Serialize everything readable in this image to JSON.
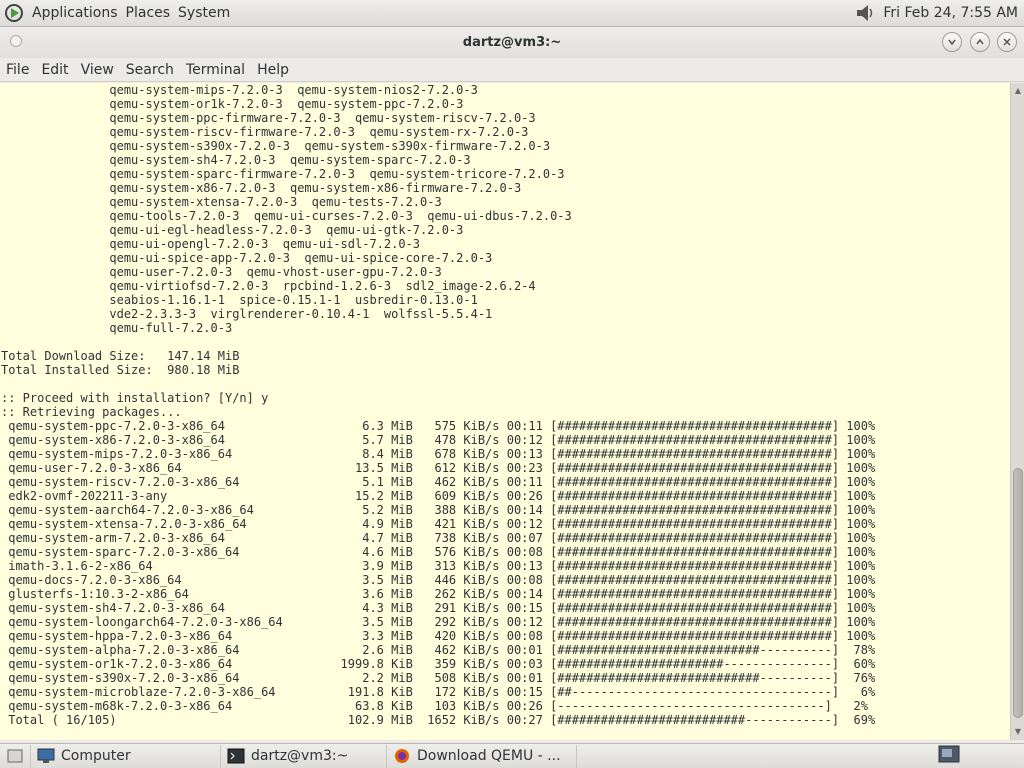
{
  "topbar": {
    "menus": [
      "Applications",
      "Places",
      "System"
    ],
    "clock": "Fri Feb 24,  7:55 AM"
  },
  "window": {
    "title": "dartz@vm3:~"
  },
  "menubar": [
    "File",
    "Edit",
    "View",
    "Search",
    "Terminal",
    "Help"
  ],
  "terminal": {
    "lines": [
      "               qemu-system-mips-7.2.0-3  qemu-system-nios2-7.2.0-3",
      "               qemu-system-or1k-7.2.0-3  qemu-system-ppc-7.2.0-3",
      "               qemu-system-ppc-firmware-7.2.0-3  qemu-system-riscv-7.2.0-3",
      "               qemu-system-riscv-firmware-7.2.0-3  qemu-system-rx-7.2.0-3",
      "               qemu-system-s390x-7.2.0-3  qemu-system-s390x-firmware-7.2.0-3",
      "               qemu-system-sh4-7.2.0-3  qemu-system-sparc-7.2.0-3",
      "               qemu-system-sparc-firmware-7.2.0-3  qemu-system-tricore-7.2.0-3",
      "               qemu-system-x86-7.2.0-3  qemu-system-x86-firmware-7.2.0-3",
      "               qemu-system-xtensa-7.2.0-3  qemu-tests-7.2.0-3",
      "               qemu-tools-7.2.0-3  qemu-ui-curses-7.2.0-3  qemu-ui-dbus-7.2.0-3",
      "               qemu-ui-egl-headless-7.2.0-3  qemu-ui-gtk-7.2.0-3",
      "               qemu-ui-opengl-7.2.0-3  qemu-ui-sdl-7.2.0-3",
      "               qemu-ui-spice-app-7.2.0-3  qemu-ui-spice-core-7.2.0-3",
      "               qemu-user-7.2.0-3  qemu-vhost-user-gpu-7.2.0-3",
      "               qemu-virtiofsd-7.2.0-3  rpcbind-1.2.6-3  sdl2_image-2.6.2-4",
      "               seabios-1.16.1-1  spice-0.15.1-1  usbredir-0.13.0-1",
      "               vde2-2.3.3-3  virglrenderer-0.10.4-1  wolfssl-5.5.4-1",
      "               qemu-full-7.2.0-3",
      "",
      "Total Download Size:   147.14 MiB",
      "Total Installed Size:  980.18 MiB",
      "",
      ":: Proceed with installation? [Y/n] y",
      ":: Retrieving packages...",
      " qemu-system-ppc-7.2.0-3-x86_64                   6.3 MiB   575 KiB/s 00:11 [######################################] 100%",
      " qemu-system-x86-7.2.0-3-x86_64                   5.7 MiB   478 KiB/s 00:12 [######################################] 100%",
      " qemu-system-mips-7.2.0-3-x86_64                  8.4 MiB   678 KiB/s 00:13 [######################################] 100%",
      " qemu-user-7.2.0-3-x86_64                        13.5 MiB   612 KiB/s 00:23 [######################################] 100%",
      " qemu-system-riscv-7.2.0-3-x86_64                 5.1 MiB   462 KiB/s 00:11 [######################################] 100%",
      " edk2-ovmf-202211-3-any                          15.2 MiB   609 KiB/s 00:26 [######################################] 100%",
      " qemu-system-aarch64-7.2.0-3-x86_64               5.2 MiB   388 KiB/s 00:14 [######################################] 100%",
      " qemu-system-xtensa-7.2.0-3-x86_64                4.9 MiB   421 KiB/s 00:12 [######################################] 100%",
      " qemu-system-arm-7.2.0-3-x86_64                   4.7 MiB   738 KiB/s 00:07 [######################################] 100%",
      " qemu-system-sparc-7.2.0-3-x86_64                 4.6 MiB   576 KiB/s 00:08 [######################################] 100%",
      " imath-3.1.6-2-x86_64                             3.9 MiB   313 KiB/s 00:13 [######################################] 100%",
      " qemu-docs-7.2.0-3-x86_64                         3.5 MiB   446 KiB/s 00:08 [######################################] 100%",
      " glusterfs-1:10.3-2-x86_64                        3.6 MiB   262 KiB/s 00:14 [######################################] 100%",
      " qemu-system-sh4-7.2.0-3-x86_64                   4.3 MiB   291 KiB/s 00:15 [######################################] 100%",
      " qemu-system-loongarch64-7.2.0-3-x86_64           3.5 MiB   292 KiB/s 00:12 [######################################] 100%",
      " qemu-system-hppa-7.2.0-3-x86_64                  3.3 MiB   420 KiB/s 00:08 [######################################] 100%",
      " qemu-system-alpha-7.2.0-3-x86_64                 2.6 MiB   462 KiB/s 00:01 [############################----------]  78%",
      " qemu-system-or1k-7.2.0-3-x86_64               1999.8 KiB   359 KiB/s 00:03 [#######################---------------]  60%",
      " qemu-system-s390x-7.2.0-3-x86_64                 2.2 MiB   508 KiB/s 00:01 [############################----------]  76%",
      " qemu-system-microblaze-7.2.0-3-x86_64          191.8 KiB   172 KiB/s 00:15 [##------------------------------------]   6%",
      " qemu-system-m68k-7.2.0-3-x86_64                 63.8 KiB   103 KiB/s 00:26 [-------------------------------------]   2%",
      " Total ( 16/105)                                102.9 MiB  1652 KiB/s 00:27 [##########################------------]  69%"
    ]
  },
  "taskbar": {
    "items": [
      "Computer",
      "dartz@vm3:~",
      "Download QEMU - ..."
    ]
  }
}
